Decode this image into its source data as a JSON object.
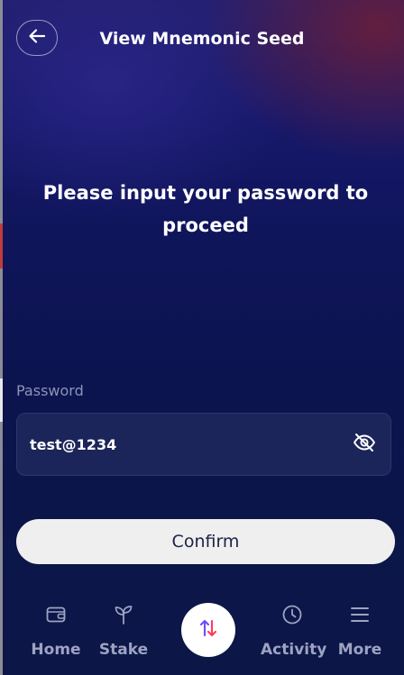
{
  "header": {
    "title": "View Mnemonic Seed",
    "back_icon": "arrow-left-icon"
  },
  "main": {
    "prompt": "Please input your password to proceed",
    "password": {
      "label": "Password",
      "value": "test@1234",
      "visibility_icon": "eye-off-icon"
    },
    "confirm_label": "Confirm"
  },
  "nav": {
    "items": [
      {
        "label": "Home",
        "icon": "wallet-icon"
      },
      {
        "label": "Stake",
        "icon": "sprout-icon"
      },
      {
        "label": "Activity",
        "icon": "clock-icon"
      },
      {
        "label": "More",
        "icon": "menu-icon"
      }
    ],
    "center_icon": "swap-arrows-icon"
  },
  "colors": {
    "accent_swap_up": "#6c4bff",
    "accent_swap_down": "#ff3a5c",
    "label_muted": "#8e93b5",
    "button_bg": "#efefef"
  }
}
